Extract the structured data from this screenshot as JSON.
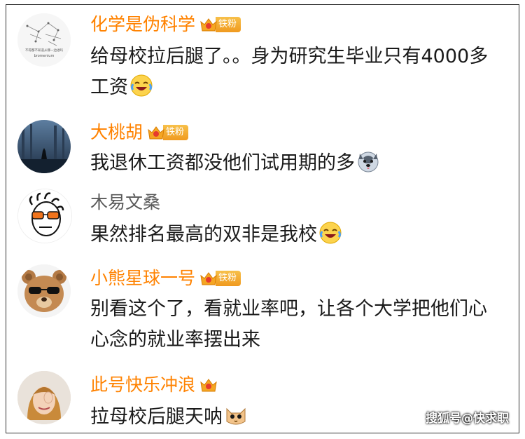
{
  "comments": [
    {
      "name": "化学是伪科学",
      "badge": "铁粉",
      "text": "给母校拉后腿了。。身为研究生毕业只有4000多工资",
      "emoji": "laugh-cry-emoji",
      "avatar": "sketch-avatar"
    },
    {
      "name": "大桃胡",
      "badge": "铁粉",
      "text": "我退休工资都没他们试用期的多",
      "emoji": "husky-emoji",
      "avatar": "wolf-forest-avatar"
    },
    {
      "name": "木易文桑",
      "text": "果然排名最高的双非是我校",
      "emoji": "laugh-cry-emoji",
      "avatar": "cartoon-face-avatar"
    },
    {
      "name": "小熊星球一号",
      "badge": "铁粉",
      "text": "别看这个了，看就业率吧，让各个大学把他们心心念的就业率摆出来",
      "avatar": "teddy-bear-avatar"
    },
    {
      "name": "此号快乐冲浪",
      "text": "拉母校后腿天呐",
      "emoji": "cat-emoji",
      "avatar": "girl-photo-avatar"
    }
  ],
  "avatar_text": {
    "line1": "不得都不知道从哪一边进吗",
    "line2": "bromenium"
  },
  "watermark": "搜狐号@快求职",
  "colors": {
    "name": "#ff8200",
    "name_plain": "#5a5a5a",
    "text": "#1a1a1a",
    "badge": "#f09a1f"
  }
}
